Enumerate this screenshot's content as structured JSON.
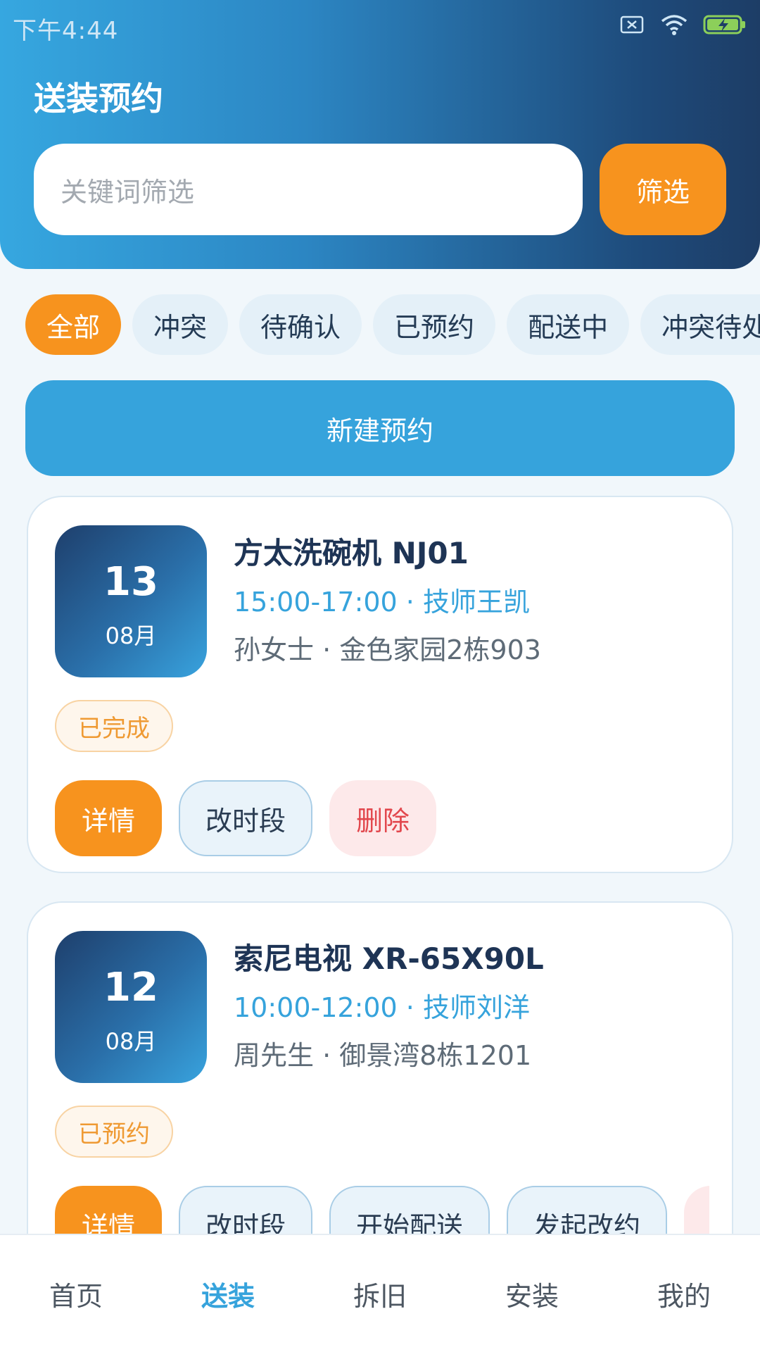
{
  "status_bar": {
    "time": "下午4:44"
  },
  "header": {
    "title": "送装预约",
    "search_placeholder": "关键词筛选",
    "filter_label": "筛选"
  },
  "tabs": [
    {
      "label": "全部",
      "active": true
    },
    {
      "label": "冲突",
      "active": false
    },
    {
      "label": "待确认",
      "active": false
    },
    {
      "label": "已预约",
      "active": false
    },
    {
      "label": "配送中",
      "active": false
    },
    {
      "label": "冲突待处",
      "active": false
    }
  ],
  "new_button_label": "新建预约",
  "cards": [
    {
      "day": "13",
      "month": "08月",
      "title": "方太洗碗机 NJ01",
      "time_tech": "15:00-17:00 · 技师王凯",
      "customer_addr": "孙女士 · 金色家园2栋903",
      "status": "已完成",
      "actions": [
        {
          "label": "详情",
          "style": "primary"
        },
        {
          "label": "改时段",
          "style": "outline"
        },
        {
          "label": "删除",
          "style": "danger"
        }
      ]
    },
    {
      "day": "12",
      "month": "08月",
      "title": "索尼电视 XR-65X90L",
      "time_tech": "10:00-12:00 · 技师刘洋",
      "customer_addr": "周先生 · 御景湾8栋1201",
      "status": "已预约",
      "actions": [
        {
          "label": "详情",
          "style": "primary"
        },
        {
          "label": "改时段",
          "style": "outline"
        },
        {
          "label": "开始配送",
          "style": "outline"
        },
        {
          "label": "发起改约",
          "style": "outline"
        },
        {
          "label": "",
          "style": "danger"
        }
      ]
    }
  ],
  "bottom_nav": [
    {
      "label": "首页",
      "active": false
    },
    {
      "label": "送装",
      "active": true
    },
    {
      "label": "拆旧",
      "active": false
    },
    {
      "label": "安装",
      "active": false
    },
    {
      "label": "我的",
      "active": false
    }
  ],
  "colors": {
    "accent_orange": "#f7931e",
    "accent_blue": "#36a3dc",
    "header_dark": "#1d3d66"
  }
}
